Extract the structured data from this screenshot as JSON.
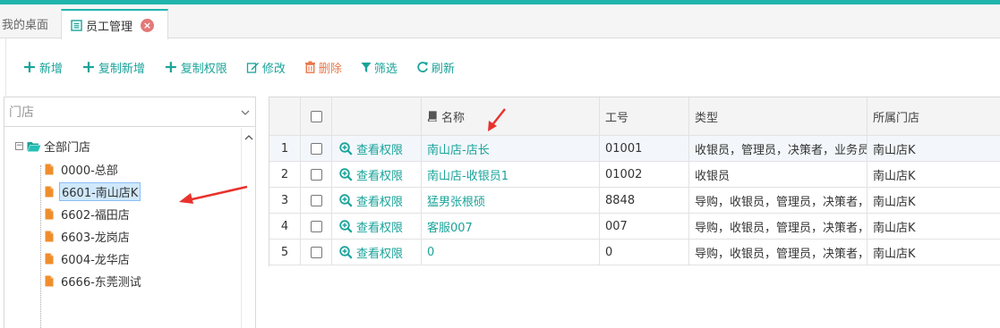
{
  "tabs": {
    "desktop": "我的桌面",
    "active": "员工管理",
    "close_glyph": "×"
  },
  "toolbar": {
    "add": "新增",
    "copy_add": "复制新增",
    "copy_perm": "复制权限",
    "edit": "修改",
    "delete": "删除",
    "filter": "筛选",
    "refresh": "刷新"
  },
  "store_select": {
    "placeholder": "门店"
  },
  "tree": {
    "root": "全部门店",
    "children": [
      "0000-总部",
      "6601-南山店K",
      "6602-福田店",
      "6603-龙岗店",
      "6004-龙华店",
      "6666-东莞测试"
    ],
    "selected_index": 1
  },
  "grid": {
    "headers": {
      "name": "名称",
      "no": "工号",
      "type": "类型",
      "store": "所属门店"
    },
    "rows": [
      {
        "idx": "1",
        "action": "查看权限",
        "name": "南山店-店长",
        "no": "01001",
        "type": "收银员，管理员，决策者，业务员",
        "store": "南山店K"
      },
      {
        "idx": "2",
        "action": "查看权限",
        "name": "南山店-收银员1",
        "no": "01002",
        "type": "收银员",
        "store": "南山店K"
      },
      {
        "idx": "3",
        "action": "查看权限",
        "name": "猛男张根硕",
        "no": "8848",
        "type": "导购，收银员，管理员，决策者，",
        "store": "南山店K"
      },
      {
        "idx": "4",
        "action": "查看权限",
        "name": "客服007",
        "no": "007",
        "type": "导购，收银员，管理员，决策者，",
        "store": "南山店K"
      },
      {
        "idx": "5",
        "action": "查看权限",
        "name": "0",
        "no": "0",
        "type": "导购，收银员，管理员，决策者，",
        "store": "南山店K"
      }
    ]
  },
  "colors": {
    "accent": "#1fb5ad",
    "link": "#1aa39a",
    "danger": "#e8784a",
    "arrow": "#e8322c"
  }
}
